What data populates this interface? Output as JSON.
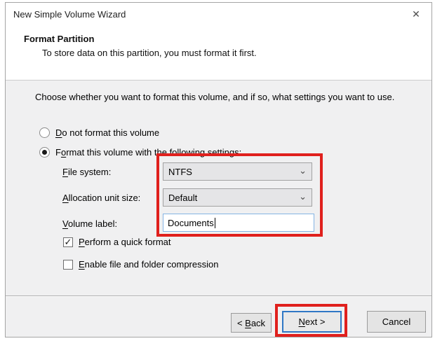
{
  "window": {
    "title": "New Simple Volume Wizard",
    "close_icon": "✕"
  },
  "header": {
    "title": "Format Partition",
    "subtitle": "To store data on this partition, you must format it first."
  },
  "body": {
    "instruction": "Choose whether you want to format this volume, and if so, what settings you want to use.",
    "radios": [
      {
        "pre": "",
        "key": "D",
        "post": "o not format this volume",
        "selected": false
      },
      {
        "pre": "F",
        "key": "o",
        "post": "rmat this volume with the following settings:",
        "selected": true
      }
    ],
    "fields": [
      {
        "pre": "",
        "key": "F",
        "post": "ile system:",
        "value": "NTFS",
        "control": "dropdown"
      },
      {
        "pre": "",
        "key": "A",
        "post": "llocation unit size:",
        "value": "Default",
        "control": "dropdown"
      },
      {
        "pre": "",
        "key": "V",
        "post": "olume label:",
        "value": "Documents",
        "control": "textbox"
      }
    ],
    "checkboxes": [
      {
        "pre": "",
        "key": "P",
        "post": "erform a quick format",
        "checked": true
      },
      {
        "pre": "",
        "key": "E",
        "post": "nable file and folder compression",
        "checked": false
      }
    ],
    "check_glyph": "✓"
  },
  "icons": {
    "chevron": "⌄"
  },
  "footer": {
    "back": {
      "pre": "< ",
      "key": "B",
      "post": "ack"
    },
    "next": {
      "pre": "",
      "key": "N",
      "post": "ext >"
    },
    "cancel": {
      "label": "Cancel"
    }
  },
  "annotations": {
    "highlight_color": "#e0201d"
  }
}
